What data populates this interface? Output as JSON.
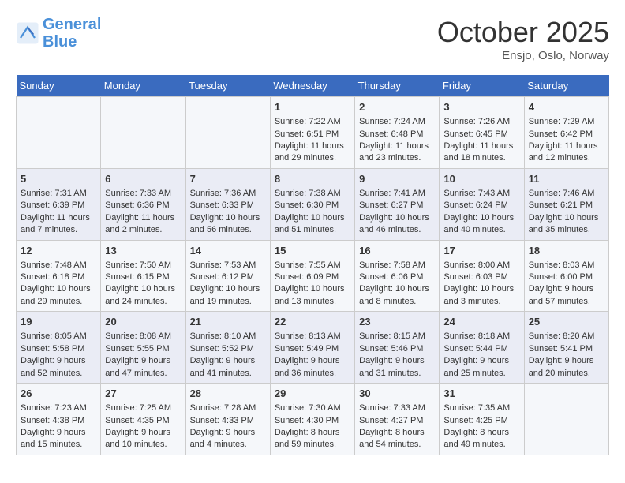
{
  "header": {
    "logo_line1": "General",
    "logo_line2": "Blue",
    "month": "October 2025",
    "location": "Ensjo, Oslo, Norway"
  },
  "weekdays": [
    "Sunday",
    "Monday",
    "Tuesday",
    "Wednesday",
    "Thursday",
    "Friday",
    "Saturday"
  ],
  "weeks": [
    [
      {
        "day": "",
        "content": ""
      },
      {
        "day": "",
        "content": ""
      },
      {
        "day": "",
        "content": ""
      },
      {
        "day": "1",
        "content": "Sunrise: 7:22 AM\nSunset: 6:51 PM\nDaylight: 11 hours\nand 29 minutes."
      },
      {
        "day": "2",
        "content": "Sunrise: 7:24 AM\nSunset: 6:48 PM\nDaylight: 11 hours\nand 23 minutes."
      },
      {
        "day": "3",
        "content": "Sunrise: 7:26 AM\nSunset: 6:45 PM\nDaylight: 11 hours\nand 18 minutes."
      },
      {
        "day": "4",
        "content": "Sunrise: 7:29 AM\nSunset: 6:42 PM\nDaylight: 11 hours\nand 12 minutes."
      }
    ],
    [
      {
        "day": "5",
        "content": "Sunrise: 7:31 AM\nSunset: 6:39 PM\nDaylight: 11 hours\nand 7 minutes."
      },
      {
        "day": "6",
        "content": "Sunrise: 7:33 AM\nSunset: 6:36 PM\nDaylight: 11 hours\nand 2 minutes."
      },
      {
        "day": "7",
        "content": "Sunrise: 7:36 AM\nSunset: 6:33 PM\nDaylight: 10 hours\nand 56 minutes."
      },
      {
        "day": "8",
        "content": "Sunrise: 7:38 AM\nSunset: 6:30 PM\nDaylight: 10 hours\nand 51 minutes."
      },
      {
        "day": "9",
        "content": "Sunrise: 7:41 AM\nSunset: 6:27 PM\nDaylight: 10 hours\nand 46 minutes."
      },
      {
        "day": "10",
        "content": "Sunrise: 7:43 AM\nSunset: 6:24 PM\nDaylight: 10 hours\nand 40 minutes."
      },
      {
        "day": "11",
        "content": "Sunrise: 7:46 AM\nSunset: 6:21 PM\nDaylight: 10 hours\nand 35 minutes."
      }
    ],
    [
      {
        "day": "12",
        "content": "Sunrise: 7:48 AM\nSunset: 6:18 PM\nDaylight: 10 hours\nand 29 minutes."
      },
      {
        "day": "13",
        "content": "Sunrise: 7:50 AM\nSunset: 6:15 PM\nDaylight: 10 hours\nand 24 minutes."
      },
      {
        "day": "14",
        "content": "Sunrise: 7:53 AM\nSunset: 6:12 PM\nDaylight: 10 hours\nand 19 minutes."
      },
      {
        "day": "15",
        "content": "Sunrise: 7:55 AM\nSunset: 6:09 PM\nDaylight: 10 hours\nand 13 minutes."
      },
      {
        "day": "16",
        "content": "Sunrise: 7:58 AM\nSunset: 6:06 PM\nDaylight: 10 hours\nand 8 minutes."
      },
      {
        "day": "17",
        "content": "Sunrise: 8:00 AM\nSunset: 6:03 PM\nDaylight: 10 hours\nand 3 minutes."
      },
      {
        "day": "18",
        "content": "Sunrise: 8:03 AM\nSunset: 6:00 PM\nDaylight: 9 hours\nand 57 minutes."
      }
    ],
    [
      {
        "day": "19",
        "content": "Sunrise: 8:05 AM\nSunset: 5:58 PM\nDaylight: 9 hours\nand 52 minutes."
      },
      {
        "day": "20",
        "content": "Sunrise: 8:08 AM\nSunset: 5:55 PM\nDaylight: 9 hours\nand 47 minutes."
      },
      {
        "day": "21",
        "content": "Sunrise: 8:10 AM\nSunset: 5:52 PM\nDaylight: 9 hours\nand 41 minutes."
      },
      {
        "day": "22",
        "content": "Sunrise: 8:13 AM\nSunset: 5:49 PM\nDaylight: 9 hours\nand 36 minutes."
      },
      {
        "day": "23",
        "content": "Sunrise: 8:15 AM\nSunset: 5:46 PM\nDaylight: 9 hours\nand 31 minutes."
      },
      {
        "day": "24",
        "content": "Sunrise: 8:18 AM\nSunset: 5:44 PM\nDaylight: 9 hours\nand 25 minutes."
      },
      {
        "day": "25",
        "content": "Sunrise: 8:20 AM\nSunset: 5:41 PM\nDaylight: 9 hours\nand 20 minutes."
      }
    ],
    [
      {
        "day": "26",
        "content": "Sunrise: 7:23 AM\nSunset: 4:38 PM\nDaylight: 9 hours\nand 15 minutes."
      },
      {
        "day": "27",
        "content": "Sunrise: 7:25 AM\nSunset: 4:35 PM\nDaylight: 9 hours\nand 10 minutes."
      },
      {
        "day": "28",
        "content": "Sunrise: 7:28 AM\nSunset: 4:33 PM\nDaylight: 9 hours\nand 4 minutes."
      },
      {
        "day": "29",
        "content": "Sunrise: 7:30 AM\nSunset: 4:30 PM\nDaylight: 8 hours\nand 59 minutes."
      },
      {
        "day": "30",
        "content": "Sunrise: 7:33 AM\nSunset: 4:27 PM\nDaylight: 8 hours\nand 54 minutes."
      },
      {
        "day": "31",
        "content": "Sunrise: 7:35 AM\nSunset: 4:25 PM\nDaylight: 8 hours\nand 49 minutes."
      },
      {
        "day": "",
        "content": ""
      }
    ]
  ]
}
